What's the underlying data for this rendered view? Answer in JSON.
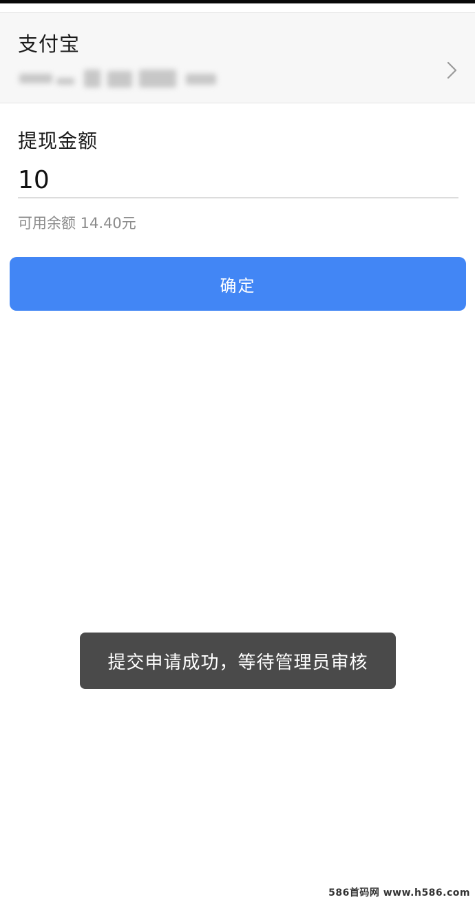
{
  "account": {
    "method_label": "支付宝",
    "chevron_icon": "chevron-right-icon"
  },
  "withdraw": {
    "amount_label": "提现金额",
    "amount_value": "10",
    "balance_text": "可用余额 14.40元"
  },
  "actions": {
    "confirm_label": "确定"
  },
  "toast": {
    "message": "提交申请成功，等待管理员审核"
  },
  "watermark": {
    "text": "586首码网 www.h586.com"
  },
  "colors": {
    "accent": "#4286f5",
    "toast_bg": "#4a4a4a",
    "muted_text": "#8a8a8a"
  }
}
